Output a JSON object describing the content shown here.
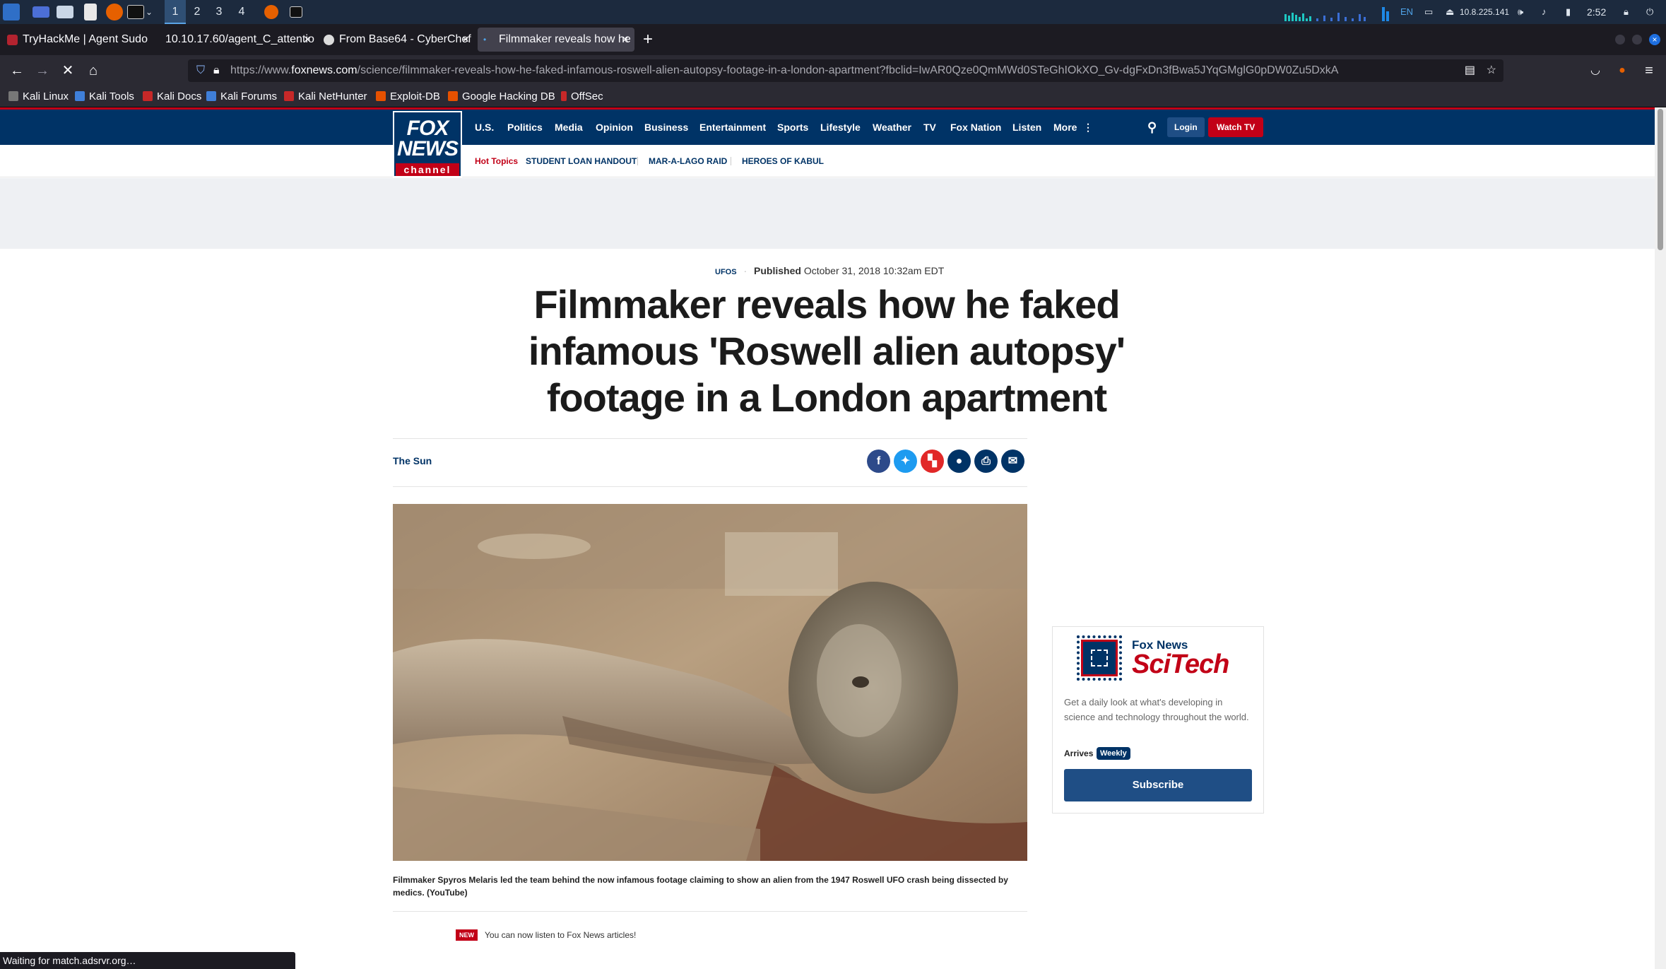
{
  "taskbar": {
    "workspaces": [
      "1",
      "2",
      "3",
      "4"
    ],
    "lang": "EN",
    "ip": "10.8.225.141",
    "time": "2:52"
  },
  "tabs": [
    {
      "title": "TryHackMe | Agent Sudo",
      "active": false
    },
    {
      "title": "10.10.17.60/agent_C_attentio",
      "active": false
    },
    {
      "title": "From Base64 - CyberChef",
      "active": false
    },
    {
      "title": "Filmmaker reveals how he",
      "active": true
    }
  ],
  "new_tab": "+",
  "url": {
    "prefix": "https://www.",
    "domain": "foxnews.com",
    "path": "/science/filmmaker-reveals-how-he-faked-infamous-roswell-alien-autopsy-footage-in-a-london-apartment?fbclid=IwAR0Qze0QmMWd0STeGhIOkXO_Gv-dgFxDn3fBwa5JYqGMglG0pDW0Zu5DxkA"
  },
  "bookmarks": [
    "Kali Linux",
    "Kali Tools",
    "Kali Docs",
    "Kali Forums",
    "Kali NetHunter",
    "Exploit-DB",
    "Google Hacking DB",
    "OffSec"
  ],
  "site": {
    "logo_line1": "FOX",
    "logo_line2": "NEWS",
    "logo_line3": "channel",
    "nav": [
      "U.S.",
      "Politics",
      "Media",
      "Opinion",
      "Business",
      "Entertainment",
      "Sports",
      "Lifestyle",
      "Weather",
      "TV",
      "Fox Nation",
      "Listen",
      "More"
    ],
    "login": "Login",
    "watch_tv": "Watch TV",
    "hot_topics_label": "Hot Topics",
    "hot_topics": [
      "STUDENT LOAN HANDOUT",
      "MAR-A-LAGO RAID",
      "HEROES OF KABUL"
    ]
  },
  "article": {
    "category": "UFOS",
    "published_label": "Published",
    "published_date": "October 31, 2018 10:32am EDT",
    "headline": "Filmmaker reveals how he faked infamous 'Roswell alien autopsy' footage in a London apartment",
    "source": "The Sun",
    "share_icons": [
      "facebook-icon",
      "twitter-icon",
      "flipboard-icon",
      "comment-icon",
      "print-icon",
      "email-icon"
    ],
    "caption": "Filmmaker Spyros Melaris led the team behind the now infamous footage claiming to show an alien from the 1947 Roswell UFO crash being dissected by medics. (YouTube)",
    "new_badge": "NEW",
    "listen_text": "You can now listen to Fox News articles!"
  },
  "newsletter": {
    "brand_top": "Fox News",
    "brand_main": "SciTech",
    "description": "Get a daily look at what's developing in science and technology throughout the world.",
    "arrives_label": "Arrives",
    "frequency": "Weekly",
    "subscribe": "Subscribe"
  },
  "status": "Waiting for match.adsrvr.org…",
  "colors": {
    "fox_blue": "#003366",
    "fox_red": "#c20017",
    "subscribe": "#1f4e85"
  }
}
